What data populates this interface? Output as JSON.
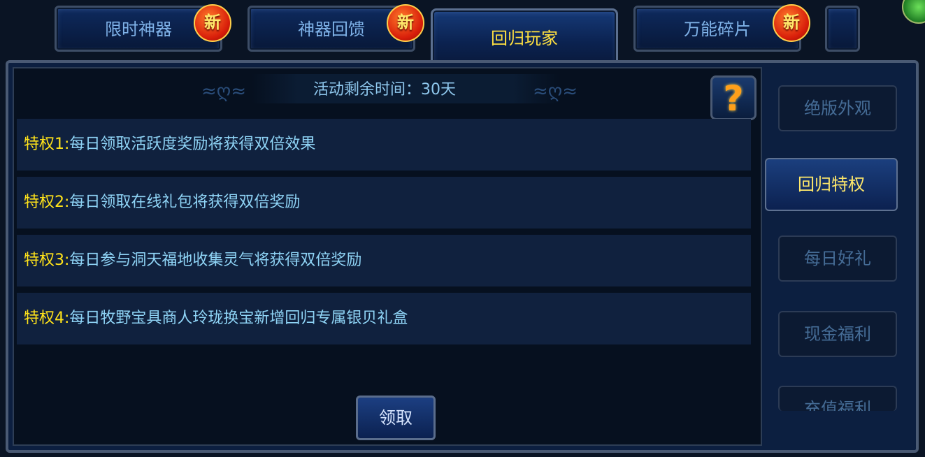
{
  "tabs": [
    {
      "label": "限时神器",
      "badge": "新"
    },
    {
      "label": "神器回馈",
      "badge": "新"
    },
    {
      "label": "回归玩家",
      "active": true
    },
    {
      "label": "万能碎片",
      "badge": "新"
    }
  ],
  "timer": {
    "text": "活动剩余时间：30天"
  },
  "help": {
    "icon": "question-icon",
    "glyph": "?"
  },
  "privileges": [
    {
      "label": "特权1:",
      "text": "每日领取活跃度奖励将获得双倍效果"
    },
    {
      "label": "特权2:",
      "text": "每日领取在线礼包将获得双倍奖励"
    },
    {
      "label": "特权3:",
      "text": "每日参与洞天福地收集灵气将获得双倍奖励"
    },
    {
      "label": "特权4:",
      "text": "每日牧野宝具商人玲珑换宝新增回归专属银贝礼盒"
    }
  ],
  "claim_button": "领取",
  "side_menu": [
    {
      "label": "绝版外观"
    },
    {
      "label": "回归特权",
      "active": true
    },
    {
      "label": "每日好礼"
    },
    {
      "label": "现金福利"
    },
    {
      "label": "充值福利"
    }
  ],
  "colors": {
    "accent_yellow": "#ffe31a",
    "text_blue": "#8fd4f6",
    "badge_red": "#d81e0a"
  }
}
